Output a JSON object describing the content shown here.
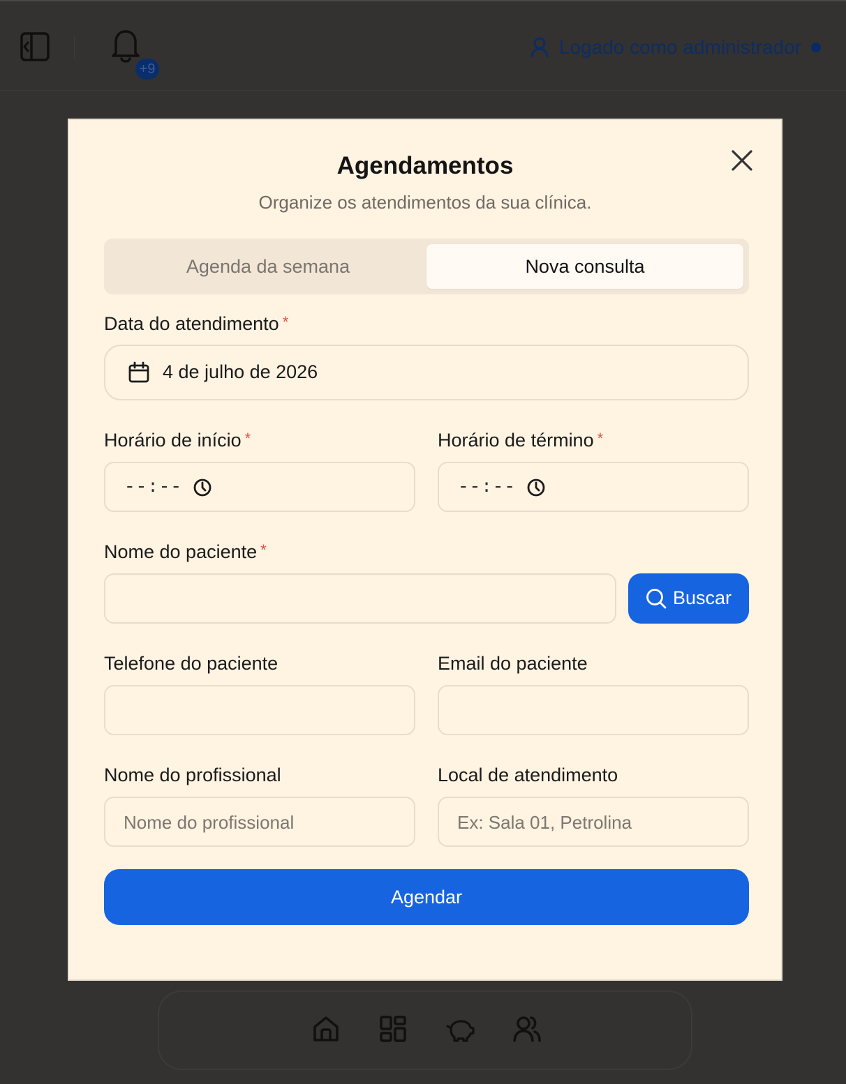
{
  "header": {
    "notifications_badge": "+9",
    "user_status": "Logado como administrador"
  },
  "modal": {
    "title": "Agendamentos",
    "subtitle": "Organize os atendimentos da sua clínica.",
    "tabs": [
      {
        "label": "Agenda da semana",
        "active": false
      },
      {
        "label": "Nova consulta",
        "active": true
      }
    ],
    "form": {
      "date_label": "Data do atendimento",
      "date_value": "4 de julho de 2026",
      "start_label": "Horário de início",
      "start_value": "--:--",
      "end_label": "Horário de término",
      "end_value": "--:--",
      "patient_name_label": "Nome do paciente",
      "patient_name_value": "",
      "search_label": "Buscar",
      "patient_phone_label": "Telefone do paciente",
      "patient_phone_value": "",
      "patient_email_label": "Email do paciente",
      "patient_email_value": "",
      "professional_label": "Nome do profissional",
      "professional_placeholder": "Nome do profissional",
      "location_label": "Local de atendimento",
      "location_placeholder": "Ex: Sala 01, Petrolina",
      "required_marker": "*",
      "submit_label": "Agendar"
    }
  },
  "bottom_nav": {
    "items": [
      "home-icon",
      "dashboard-icon",
      "piggy-bank-icon",
      "users-icon"
    ]
  },
  "colors": {
    "accent": "#1764e1",
    "modal_bg": "#fff3e2",
    "overlay_bg": "#333230",
    "required": "#e0524a"
  }
}
